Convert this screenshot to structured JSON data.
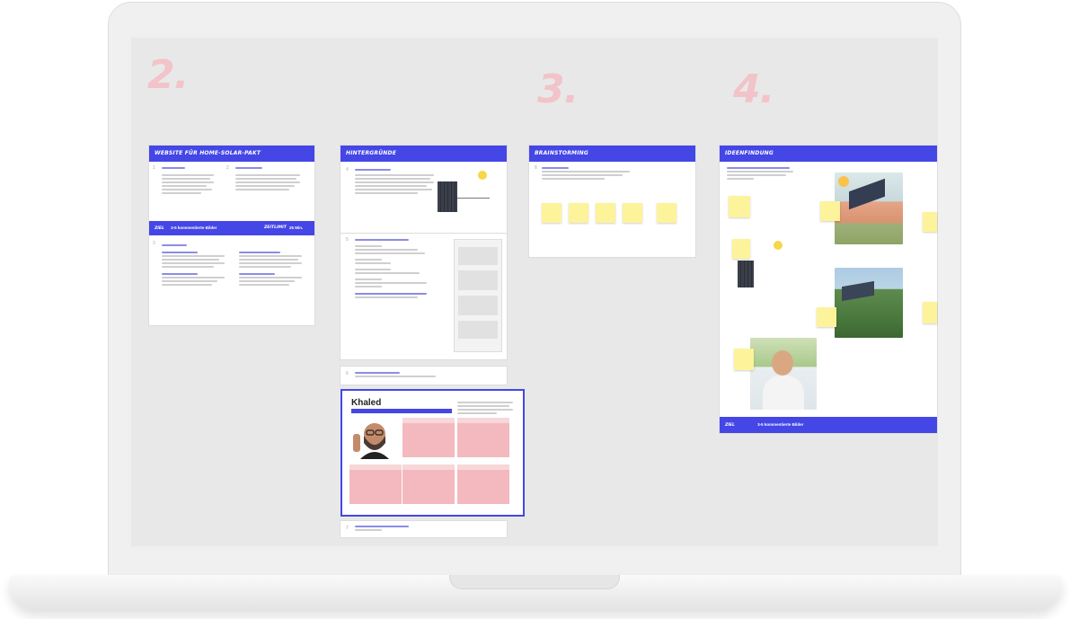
{
  "steps": {
    "s2": "2.",
    "s3": "3.",
    "s4": "4."
  },
  "board1": {
    "title": "Website für Home-Solar-Pakt",
    "band": {
      "tag": "ZIEL",
      "label": "3-5 kommentierte Bilder",
      "right_tag": "ZEITLIMIT",
      "time": "25 Min."
    }
  },
  "board2": {
    "title": "Hintergründe"
  },
  "board3": {
    "title": "Brainstorming"
  },
  "board4": {
    "title": "Ideenfindung",
    "band": {
      "tag": "ZIEL",
      "label": "3-5 kommentierte Bilder"
    }
  },
  "persona": {
    "name": "Khaled"
  },
  "colors": {
    "accent": "#4446e6",
    "sticky": "#fdf39a",
    "persona_box": "#f3b9bf",
    "numeral": "#f2c3c9"
  }
}
